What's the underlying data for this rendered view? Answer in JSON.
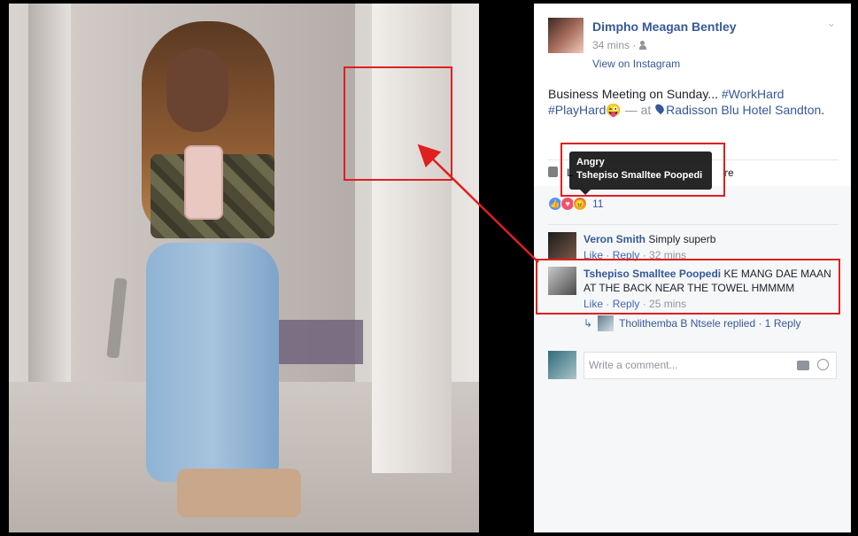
{
  "post": {
    "author": "Dimpho Meagan Bentley",
    "time": "34 mins ·",
    "audience_icon": "friends-icon",
    "view_link": "View on Instagram",
    "text_prefix": "Business Meeting on Sunday... ",
    "tag1": "#WorkHard",
    "tag2": "#PlayHard",
    "emoji": "😜",
    "at_text": " — at ",
    "place": "Radisson Blu Hotel Sandton",
    "place_suffix": "."
  },
  "like_bar": {
    "like_label": "L",
    "share_label": "re"
  },
  "tooltip": {
    "title": "Angry",
    "name": "Tshepiso Smalltee Poopedi"
  },
  "reactions": {
    "count": "11"
  },
  "comments": [
    {
      "author": "Veron Smith",
      "text": " Simply superb",
      "like": "Like",
      "sep": " · ",
      "reply": "Reply",
      "time": " · 32 mins"
    },
    {
      "author": "Tshepiso Smalltee Poopedi",
      "text": " KE MANG DAE MAAN AT THE BACK NEAR THE TOWEL HMMMM",
      "like": "Like",
      "sep": " · ",
      "reply": "Reply",
      "time": " · 25 mins"
    }
  ],
  "replies": {
    "text": "Tholithemba B Ntsele replied · 1 Reply"
  },
  "composer": {
    "placeholder": "Write a comment..."
  },
  "colors": {
    "highlight": "#e01f1f",
    "link": "#365899"
  }
}
